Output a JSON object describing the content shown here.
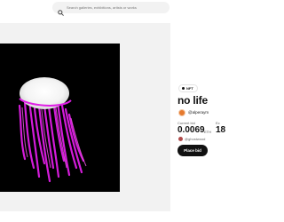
{
  "search": {
    "placeholder": "Search galleries, exhibitions, artists or works",
    "icon": "search-icon"
  },
  "artwork": {
    "alt": "no life artwork"
  },
  "badge": {
    "label": "NFT"
  },
  "title": "no life",
  "creator": {
    "name": "@alperaym"
  },
  "current_bid": {
    "label": "Current bid",
    "value": "0.0069",
    "unit": "ETH"
  },
  "ends_in": {
    "label": "Ec",
    "value": "18"
  },
  "bidder": {
    "name": "@ghostwood"
  },
  "actions": {
    "place_bid": "Place bid"
  },
  "colors": {
    "accent": "#e01ee6",
    "button": "#111111",
    "panel": "#f2f2f2"
  }
}
